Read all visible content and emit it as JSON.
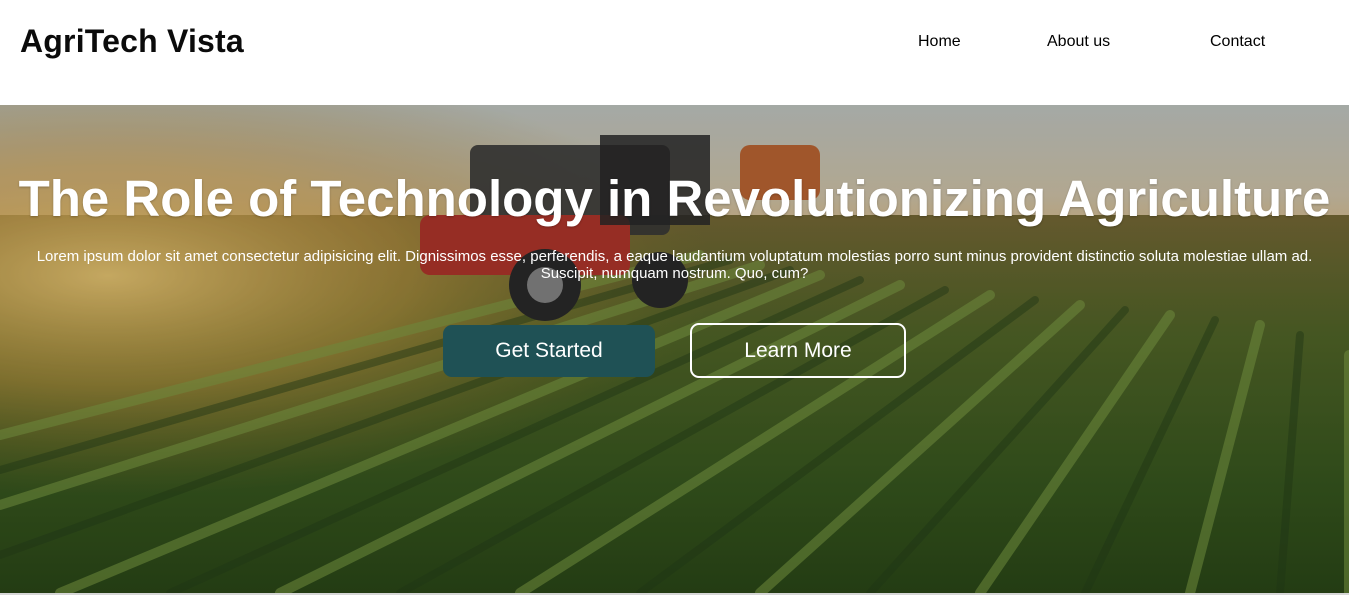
{
  "header": {
    "brand": "AgriTech Vista",
    "nav": {
      "home": "Home",
      "about": "About us",
      "contact": "Contact"
    }
  },
  "hero": {
    "title": "The Role of Technology in Revolutionizing Agriculture",
    "text": "Lorem ipsum dolor sit amet consectetur adipisicing elit. Dignissimos esse, perferendis, a eaque laudantium voluptatum molestias porro sunt minus provident distinctio soluta molestiae ullam ad. Suscipit, numquam nostrum. Quo, cum?",
    "primary_button": "Get Started",
    "secondary_button": "Learn More"
  },
  "colors": {
    "primary_button": "#1f5155",
    "text_light": "#ffffff",
    "text_dark": "#0b0b0b"
  }
}
